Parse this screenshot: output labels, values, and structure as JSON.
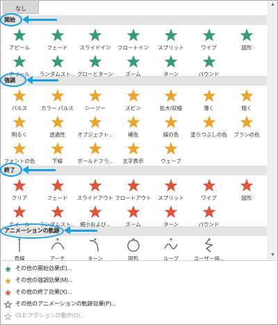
{
  "top": {
    "none_label": "なし"
  },
  "sections": {
    "entrance": "開始",
    "emphasis": "強調",
    "exit": "終了",
    "motion": "アニメーションの軌跡"
  },
  "entrance_items": [
    "アピール",
    "フェード",
    "スライドイン",
    "フロートイン",
    "スプリット",
    "ワイプ",
    "図形",
    "ホイール",
    "ランダムスト...",
    "グローとターン",
    "ズーム",
    "ターン",
    "バウンド"
  ],
  "emphasis_items": [
    "パルス",
    "カラー パルス",
    "シーソー",
    "スピン",
    "拡大/収縮",
    "薄く",
    "暗く",
    "明るく",
    "透過性",
    "オブジェクト...",
    "補色",
    "線の色",
    "塗りつぶしの色",
    "ブラシの色",
    "フォントの色",
    "下線",
    "ボールドフラ...",
    "太字表示",
    "ウェーブ"
  ],
  "exit_items": [
    "クリア",
    "フェード",
    "スライドアウト",
    "フロートアウト",
    "スプリット",
    "ワイプ",
    "図形",
    "ホイール",
    "ランダムスト...",
    "縮小および...",
    "ズーム",
    "ターン",
    "バウンド"
  ],
  "motion_items": [
    "直線",
    "アーチ",
    "ターン",
    "図形",
    "ループ",
    "ユーザー設..."
  ],
  "menu": [
    {
      "label": "その他の開始効果(E)...",
      "icon": "green-star-icon",
      "disabled": false
    },
    {
      "label": "その他の強調効果(M)...",
      "icon": "gold-star-icon",
      "disabled": false
    },
    {
      "label": "その他の終了効果(X)...",
      "icon": "red-star-icon",
      "disabled": false
    },
    {
      "label": "その他のアニメーションの軌跡効果(P)...",
      "icon": "outline-star-icon",
      "disabled": false
    },
    {
      "label": "OLE アクションの動作(O)...",
      "icon": "gear-icon",
      "disabled": true
    }
  ],
  "colors": {
    "entrance": "#3a9a78",
    "emphasis": "#e8a531",
    "exit": "#d9573f",
    "motion_accent": "#2d9a7a",
    "callout": "#1ba1e2"
  }
}
